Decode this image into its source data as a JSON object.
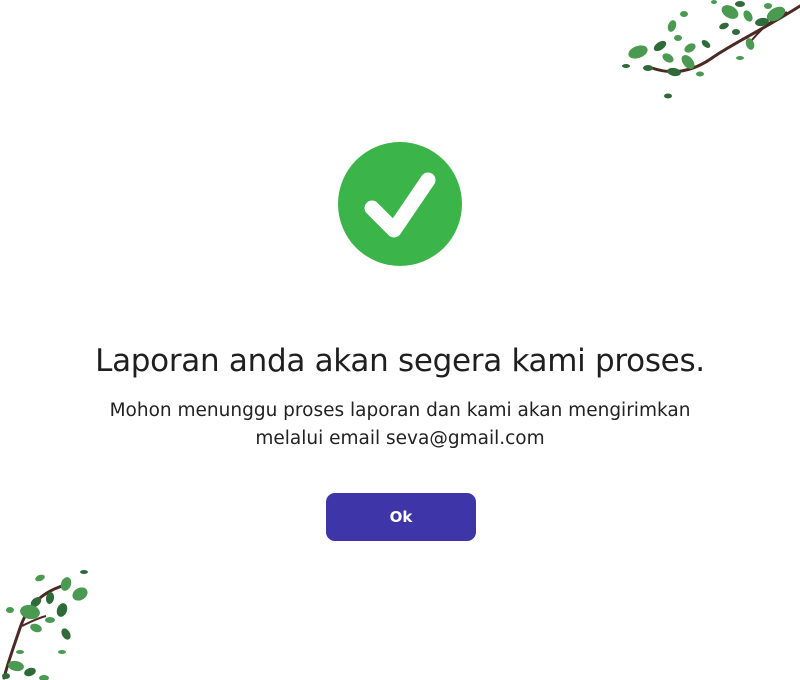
{
  "dialog": {
    "icon": "check-circle-icon",
    "title": "Laporan anda akan segera kami proses.",
    "message_line1": "Mohon menunggu proses laporan dan kami akan mengirimkan",
    "message_line2": "melalui email seva@gmail.com",
    "ok_label": "Ok"
  },
  "colors": {
    "accent": "#3d35a8",
    "success": "#3bb54a",
    "leaf_dark": "#2f6b38",
    "leaf_light": "#4a9a52",
    "branch": "#4a2a22"
  },
  "decorations": [
    "leafy-branch-top-right",
    "leafy-branch-bottom-left"
  ]
}
